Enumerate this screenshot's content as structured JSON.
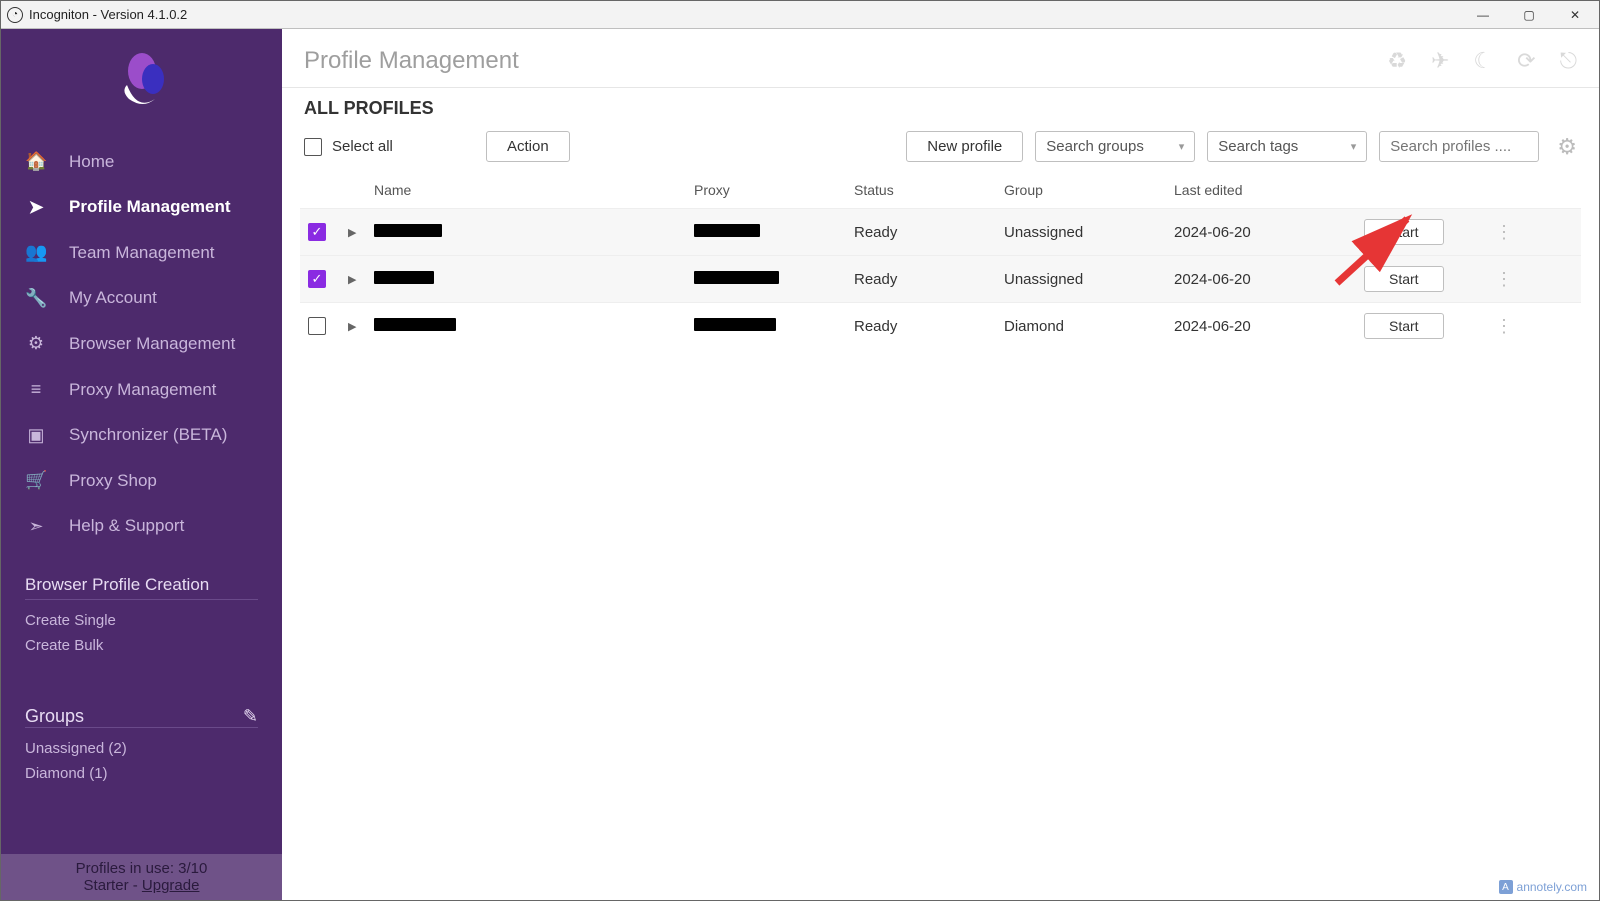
{
  "window_title": "Incogniton - Version 4.1.0.2",
  "sidebar": {
    "nav": [
      {
        "icon": "🏠",
        "label": "Home"
      },
      {
        "icon": "➤",
        "label": "Profile Management"
      },
      {
        "icon": "👥",
        "label": "Team Management"
      },
      {
        "icon": "🔧",
        "label": "My Account"
      },
      {
        "icon": "⚙",
        "label": "Browser Management"
      },
      {
        "icon": "≡",
        "label": "Proxy Management"
      },
      {
        "icon": "▣",
        "label": "Synchronizer (BETA)"
      },
      {
        "icon": "🛒",
        "label": "Proxy Shop"
      },
      {
        "icon": "➣",
        "label": "Help & Support"
      }
    ],
    "creation_header": "Browser Profile Creation",
    "create_single": "Create Single",
    "create_bulk": "Create Bulk",
    "groups_header": "Groups",
    "groups": [
      {
        "label": "Unassigned (2)"
      },
      {
        "label": "Diamond (1)"
      }
    ],
    "footer_line1": "Profiles in use:  3/10",
    "footer_plan": "Starter - ",
    "footer_link": "Upgrade"
  },
  "main": {
    "title": "Profile Management",
    "subtitle": "ALL PROFILES",
    "toolbar": {
      "select_all": "Select all",
      "action": "Action",
      "new_profile": "New profile",
      "search_groups": "Search groups",
      "search_tags": "Search tags",
      "search_profiles_placeholder": "Search profiles ...."
    },
    "columns": {
      "name": "Name",
      "proxy": "Proxy",
      "status": "Status",
      "group": "Group",
      "last_edited": "Last edited"
    },
    "rows": [
      {
        "checked": true,
        "name_w": 68,
        "proxy_w": 66,
        "status": "Ready",
        "group": "Unassigned",
        "last_edited": "2024-06-20",
        "start": "Start"
      },
      {
        "checked": true,
        "name_w": 60,
        "proxy_w": 85,
        "status": "Ready",
        "group": "Unassigned",
        "last_edited": "2024-06-20",
        "start": "Start"
      },
      {
        "checked": false,
        "name_w": 82,
        "proxy_w": 82,
        "status": "Ready",
        "group": "Diamond",
        "last_edited": "2024-06-20",
        "start": "Start"
      }
    ]
  },
  "watermark": "annotely.com"
}
